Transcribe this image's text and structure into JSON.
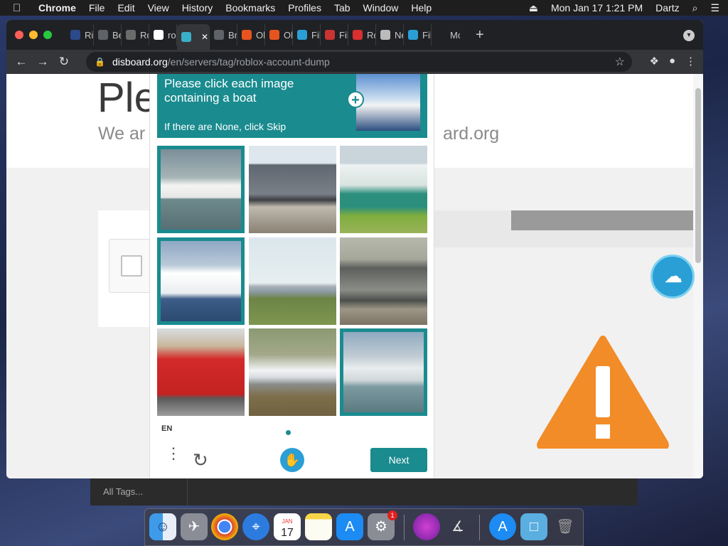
{
  "menubar": {
    "apple": "",
    "app": "Chrome",
    "items": [
      "File",
      "Edit",
      "View",
      "History",
      "Bookmarks",
      "Profiles",
      "Tab",
      "Window",
      "Help"
    ],
    "datetime": "Mon Jan 17  1:21 PM",
    "user": "Dartz"
  },
  "browser": {
    "tabs": [
      {
        "label": "Ric",
        "fav": "#2c4a8a"
      },
      {
        "label": "Be",
        "fav": "#5f6368"
      },
      {
        "label": "Ro",
        "fav": "#6b6b6b"
      },
      {
        "label": "rob",
        "fav": "#ffffff"
      },
      {
        "label": "",
        "fav": "#3ab0c8"
      },
      {
        "label": "Bry",
        "fav": "#5f6368"
      },
      {
        "label": "Ol",
        "fav": "#e8541e"
      },
      {
        "label": "Ol",
        "fav": "#e8541e"
      },
      {
        "label": "Fil",
        "fav": "#2a9fd6"
      },
      {
        "label": "Fil",
        "fav": "#cc3333"
      },
      {
        "label": "Ro",
        "fav": "#d83030"
      },
      {
        "label": "Ne",
        "fav": "#bbbbbb"
      },
      {
        "label": "Fil",
        "fav": "#2a9fd6"
      },
      {
        "label": "Mo",
        "fav": "#202124"
      }
    ],
    "url_domain": "disboard.org",
    "url_path": "/en/servers/tag/roblox-account-dump"
  },
  "page": {
    "title": "Ple",
    "subtitle_left": "We ar",
    "subtitle_right": "ard.org"
  },
  "captcha": {
    "prompt": "Please click each image containing a boat",
    "skip_hint": "If there are None, click Skip",
    "lang": "EN",
    "next_label": "Next",
    "tiles": [
      {
        "name": "boat-1",
        "selected": true
      },
      {
        "name": "train-1",
        "selected": false
      },
      {
        "name": "train-2",
        "selected": false
      },
      {
        "name": "boat-2",
        "selected": true
      },
      {
        "name": "airplane-1",
        "selected": false
      },
      {
        "name": "train-3",
        "selected": false
      },
      {
        "name": "bus-1",
        "selected": false
      },
      {
        "name": "airplane-2",
        "selected": false
      },
      {
        "name": "boat-3",
        "selected": true
      }
    ]
  },
  "tagstrip": {
    "label": "All Tags..."
  },
  "dock": {
    "calendar_month": "JAN",
    "calendar_day": "17",
    "sysprefs_badge": "1"
  }
}
